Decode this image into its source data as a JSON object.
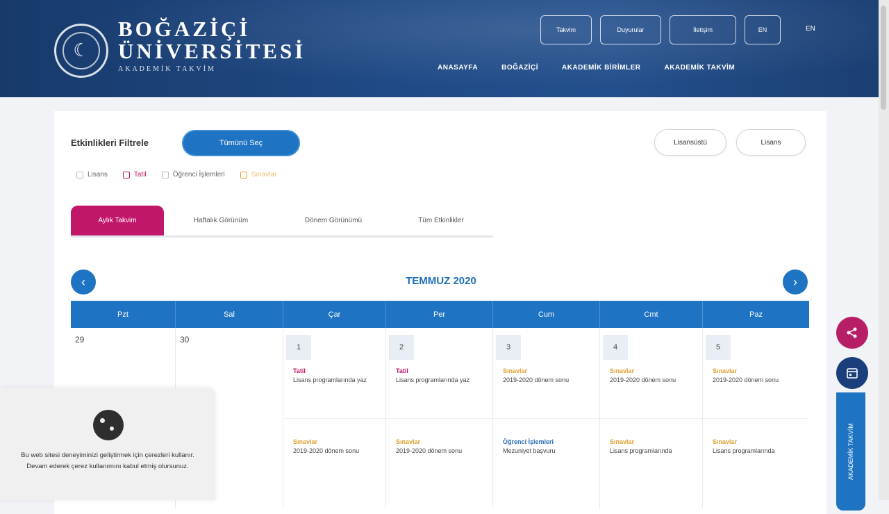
{
  "header": {
    "logo": {
      "line1": "BOĞAZİÇİ",
      "line2": "ÜNİVERSİTESİ",
      "line3": "AKADEMİK TAKVİM",
      "emblem_icon": "university-seal-icon"
    },
    "top_buttons": [
      "Takvim",
      "Duyurular",
      "İletişim",
      "EN"
    ],
    "language": "EN",
    "nav": [
      "ANASAYFA",
      "BOĞAZİÇİ",
      "AKADEMİK BİRİMLER",
      "AKADEMİK TAKVİM"
    ]
  },
  "filters": {
    "label": "Etkinlikleri Filtrele",
    "select_all": "Tümünü Seç",
    "right_pills": [
      "Lisansüstü",
      "Lisans"
    ],
    "checkboxes": [
      "Lisans",
      "Tatil",
      "Öğrenci İşlemleri",
      "Sınavlar"
    ]
  },
  "tabs": [
    "Aylık Takvim",
    "Haftalık Görünüm",
    "Dönem Görünümü",
    "Tüm Etkinlikler"
  ],
  "calendar": {
    "month": "TEMMUZ 2020",
    "prev_icon": "chevron-left-icon",
    "next_icon": "chevron-right-icon",
    "weekdays": [
      "Pzt",
      "Sal",
      "Çar",
      "Per",
      "Cum",
      "Cmt",
      "Paz"
    ],
    "days": [
      {
        "num": "29",
        "boxed": false,
        "events": []
      },
      {
        "num": "30",
        "boxed": false,
        "events": []
      },
      {
        "num": "1",
        "boxed": true,
        "events": [
          {
            "cat": "Tatil",
            "text": "Lisans programlarında yaz"
          },
          {
            "cat": "Sınavlar",
            "text": "2019-2020 dönem sonu"
          }
        ]
      },
      {
        "num": "2",
        "boxed": true,
        "events": [
          {
            "cat": "Tatil",
            "text": "Lisans programlarında yaz"
          },
          {
            "cat": "Sınavlar",
            "text": "2019-2020 dönem sonu"
          }
        ]
      },
      {
        "num": "3",
        "boxed": true,
        "events": [
          {
            "cat": "Sınavlar",
            "text": "2019-2020 dönem sonu"
          },
          {
            "cat": "Öğrenci İşlemleri",
            "text": "Mezuniyet başvuru"
          }
        ]
      },
      {
        "num": "4",
        "boxed": true,
        "events": [
          {
            "cat": "Sınavlar",
            "text": "2019-2020 dönem sonu"
          },
          {
            "cat": "Sınavlar",
            "text": "Lisans programlarında"
          }
        ]
      },
      {
        "num": "5",
        "boxed": true,
        "events": [
          {
            "cat": "Sınavlar",
            "text": "2019-2020 dönem sonu"
          },
          {
            "cat": "Sınavlar",
            "text": "Lisans programlarında"
          }
        ]
      }
    ]
  },
  "floating": {
    "share_icon": "share-icon",
    "calendar_icon": "calendar-icon",
    "side_tab": "AKADEMİK TAKVİM"
  },
  "cookie": {
    "icon": "cookie-icon",
    "text": "Bu web sitesi deneyiminizi geliştirmek için çerezleri kullanır. Devam ederek çerez kullanımını kabul etmiş olursunuz."
  },
  "colors": {
    "primary": "#1e73c2",
    "accent": "#c2166a",
    "header": "#1f4a86",
    "tatil": "#c2166a",
    "sinav": "#e0a030",
    "ogrenci": "#2a6db5"
  }
}
